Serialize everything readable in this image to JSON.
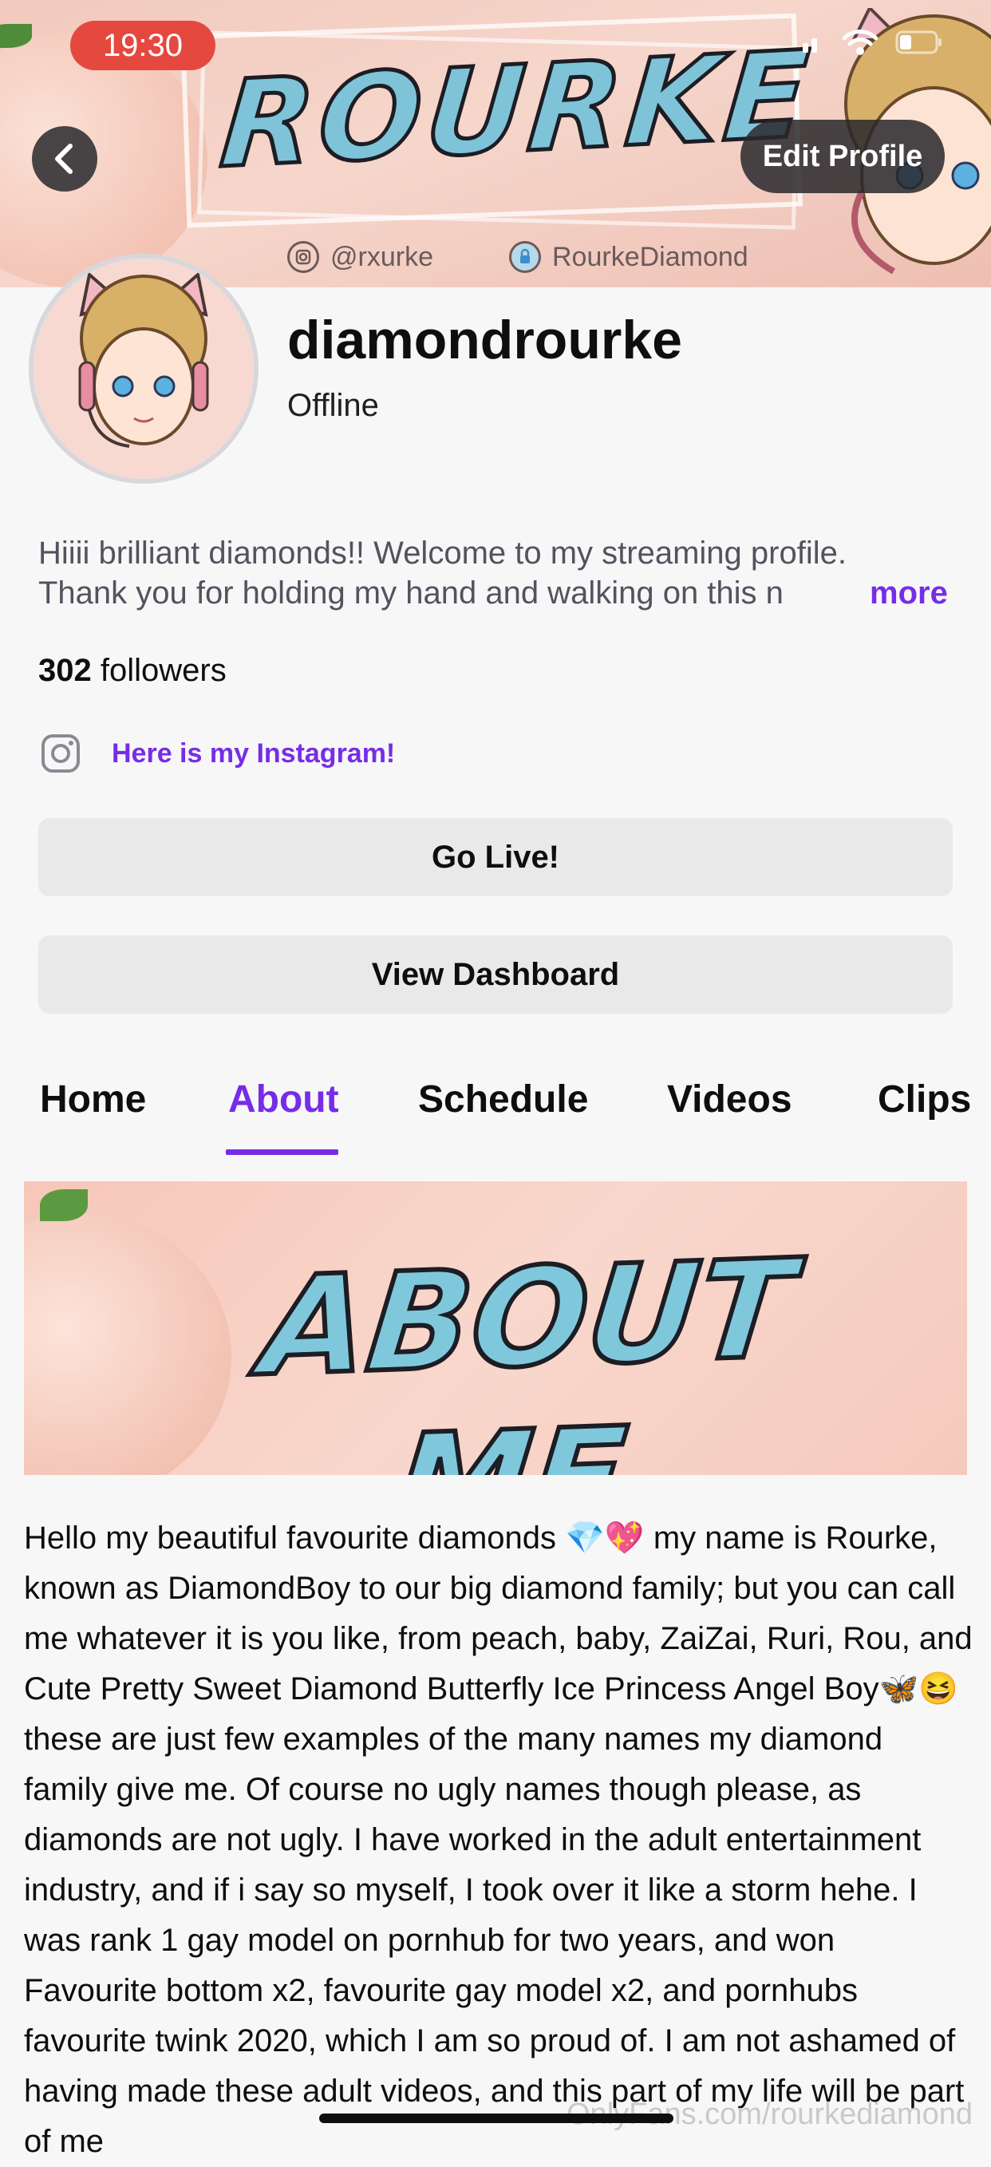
{
  "status_bar": {
    "time": "19:30"
  },
  "banner": {
    "title": "ROURKE",
    "instagram_handle": "@rxurke",
    "onlyfans_handle": "RourkeDiamond"
  },
  "nav": {
    "edit_profile_label": "Edit Profile"
  },
  "profile": {
    "username": "diamondrourke",
    "status": "Offline",
    "bio_line1": "Hiiii brilliant diamonds!! Welcome to my streaming profile.",
    "bio_line2": "Thank you for holding my hand and walking on this n",
    "bio_more": "more",
    "followers_count": "302",
    "followers_label": "followers",
    "instagram_link": "Here is my Instagram!"
  },
  "buttons": {
    "go_live": "Go Live!",
    "view_dashboard": "View Dashboard"
  },
  "tabs": [
    {
      "label": "Home"
    },
    {
      "label": "About"
    },
    {
      "label": "Schedule"
    },
    {
      "label": "Videos"
    },
    {
      "label": "Clips"
    }
  ],
  "active_tab": "About",
  "about": {
    "panel_title": "ABOUT ME",
    "body": "Hello my beautiful favourite diamonds 💎💖 my name is Rourke, known as DiamondBoy to our big diamond family; but you can call me whatever it is you like, from peach, baby, ZaiZai, Ruri, Rou, and Cute Pretty Sweet Diamond Butterfly Ice Princess Angel Boy🦋😆 these are just few examples of the many names my diamond family give me. Of course no ugly names though please, as diamonds are not ugly. I have worked in the adult entertainment industry, and if i say so myself, I took over it like a storm hehe. I was rank 1 gay model on pornhub for two years, and won Favourite bottom x2, favourite gay model x2, and pornhubs favourite twink 2020, which I am so proud of. I am not ashamed of having made these adult videos, and this part of my life will be part of me"
  },
  "watermark": "OnlyFans.com/rourkediamond",
  "colors": {
    "accent": "#772ce8",
    "time_pill": "#e5483f",
    "background": "#f7f7f8"
  },
  "icons": [
    "back-arrow-icon",
    "wifi-icon",
    "battery-icon",
    "signal-icon",
    "instagram-icon",
    "lock-icon"
  ]
}
